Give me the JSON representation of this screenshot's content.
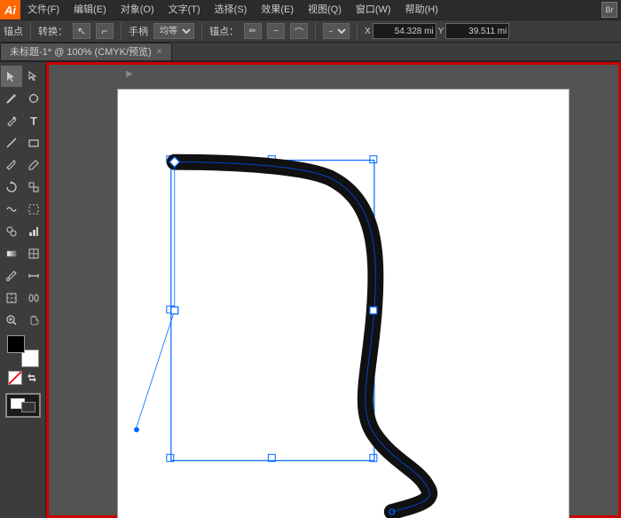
{
  "app": {
    "logo": "Ai",
    "logo_color": "#ff6600"
  },
  "menu": {
    "items": [
      "文件(F)",
      "编辑(E)",
      "对象(O)",
      "文字(T)",
      "选择(S)",
      "效果(E)",
      "视图(Q)",
      "窗口(W)",
      "帮助(H)"
    ]
  },
  "options_bar": {
    "anchor_label": "锚点",
    "transform_label": "转换：",
    "handle_label": "手柄",
    "anchor_point_label": "锚点：",
    "x_label": "X",
    "x_value": "54.328 mi",
    "y_label": "Y",
    "y_value": "39.511 mi"
  },
  "tab": {
    "title": "未标题-1* @ 100% (CMYK/预览)",
    "close": "×"
  },
  "canvas": {
    "background": "#535353",
    "artboard_bg": "#ffffff"
  }
}
